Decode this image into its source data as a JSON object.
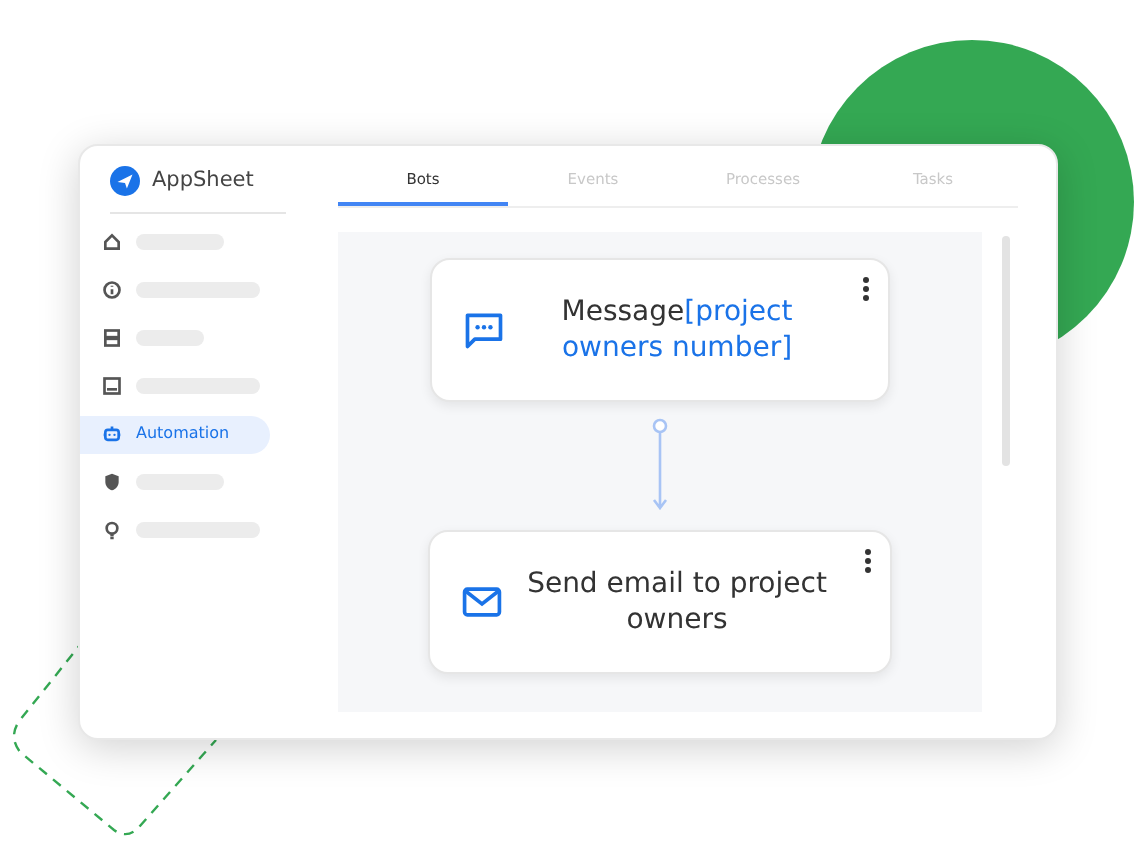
{
  "app": {
    "name": "AppSheet"
  },
  "sidebar": {
    "items": [
      {
        "selected": false
      },
      {
        "selected": false
      },
      {
        "selected": false
      },
      {
        "selected": false
      },
      {
        "label": "Automation",
        "selected": true
      },
      {
        "selected": false
      },
      {
        "selected": false
      }
    ]
  },
  "tabs": [
    {
      "label": "Bots",
      "selected": true
    },
    {
      "label": "Events",
      "selected": false
    },
    {
      "label": "Processes",
      "selected": false
    },
    {
      "label": "Tasks",
      "selected": false
    }
  ],
  "flow": {
    "steps": [
      {
        "kind": "message",
        "title": "Message",
        "highlight": "[project owners number]"
      },
      {
        "kind": "email",
        "title": "Send email to project owners"
      }
    ]
  }
}
